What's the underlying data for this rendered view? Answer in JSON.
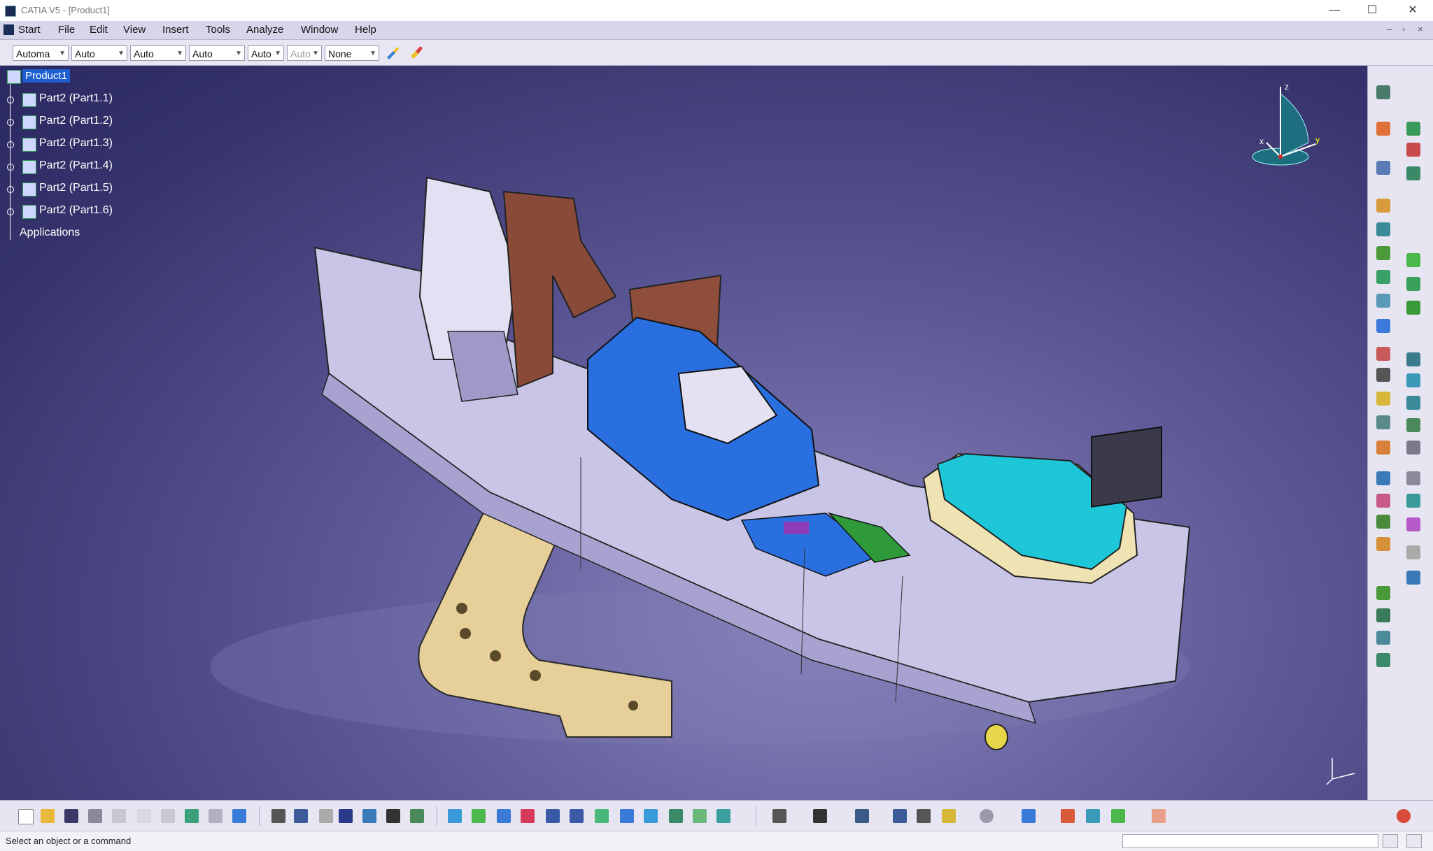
{
  "window": {
    "title": "CATIA V5 - [Product1]",
    "minimize": "—",
    "maximize": "☐",
    "close": "✕"
  },
  "menu": {
    "items": [
      "Start",
      "File",
      "Edit",
      "View",
      "Insert",
      "Tools",
      "Analyze",
      "Window",
      "Help"
    ],
    "mdi": [
      "–",
      "▫",
      "×"
    ]
  },
  "toolbar": {
    "combos": [
      {
        "value": "Automa"
      },
      {
        "value": "Auto"
      },
      {
        "value": "Auto"
      },
      {
        "value": "Auto"
      },
      {
        "value": "Auto"
      },
      {
        "value": "Auto"
      },
      {
        "value": "None"
      }
    ]
  },
  "tree": {
    "root": "Product1",
    "children": [
      "Part2 (Part1.1)",
      "Part2 (Part1.2)",
      "Part2 (Part1.3)",
      "Part2 (Part1.4)",
      "Part2 (Part1.5)",
      "Part2 (Part1.6)"
    ],
    "applications": "Applications"
  },
  "compass": {
    "x": "x",
    "y": "y",
    "z": "z"
  },
  "status": {
    "prompt": "Select an object or a command"
  },
  "colors": {
    "body": "#c9c5e6",
    "blue": "#2a6fe0",
    "cyan": "#1ec7d8",
    "cream": "#efe3b3",
    "brown": "#8a4a38",
    "tan": "#e3cc96",
    "green": "#2f9a3a"
  }
}
